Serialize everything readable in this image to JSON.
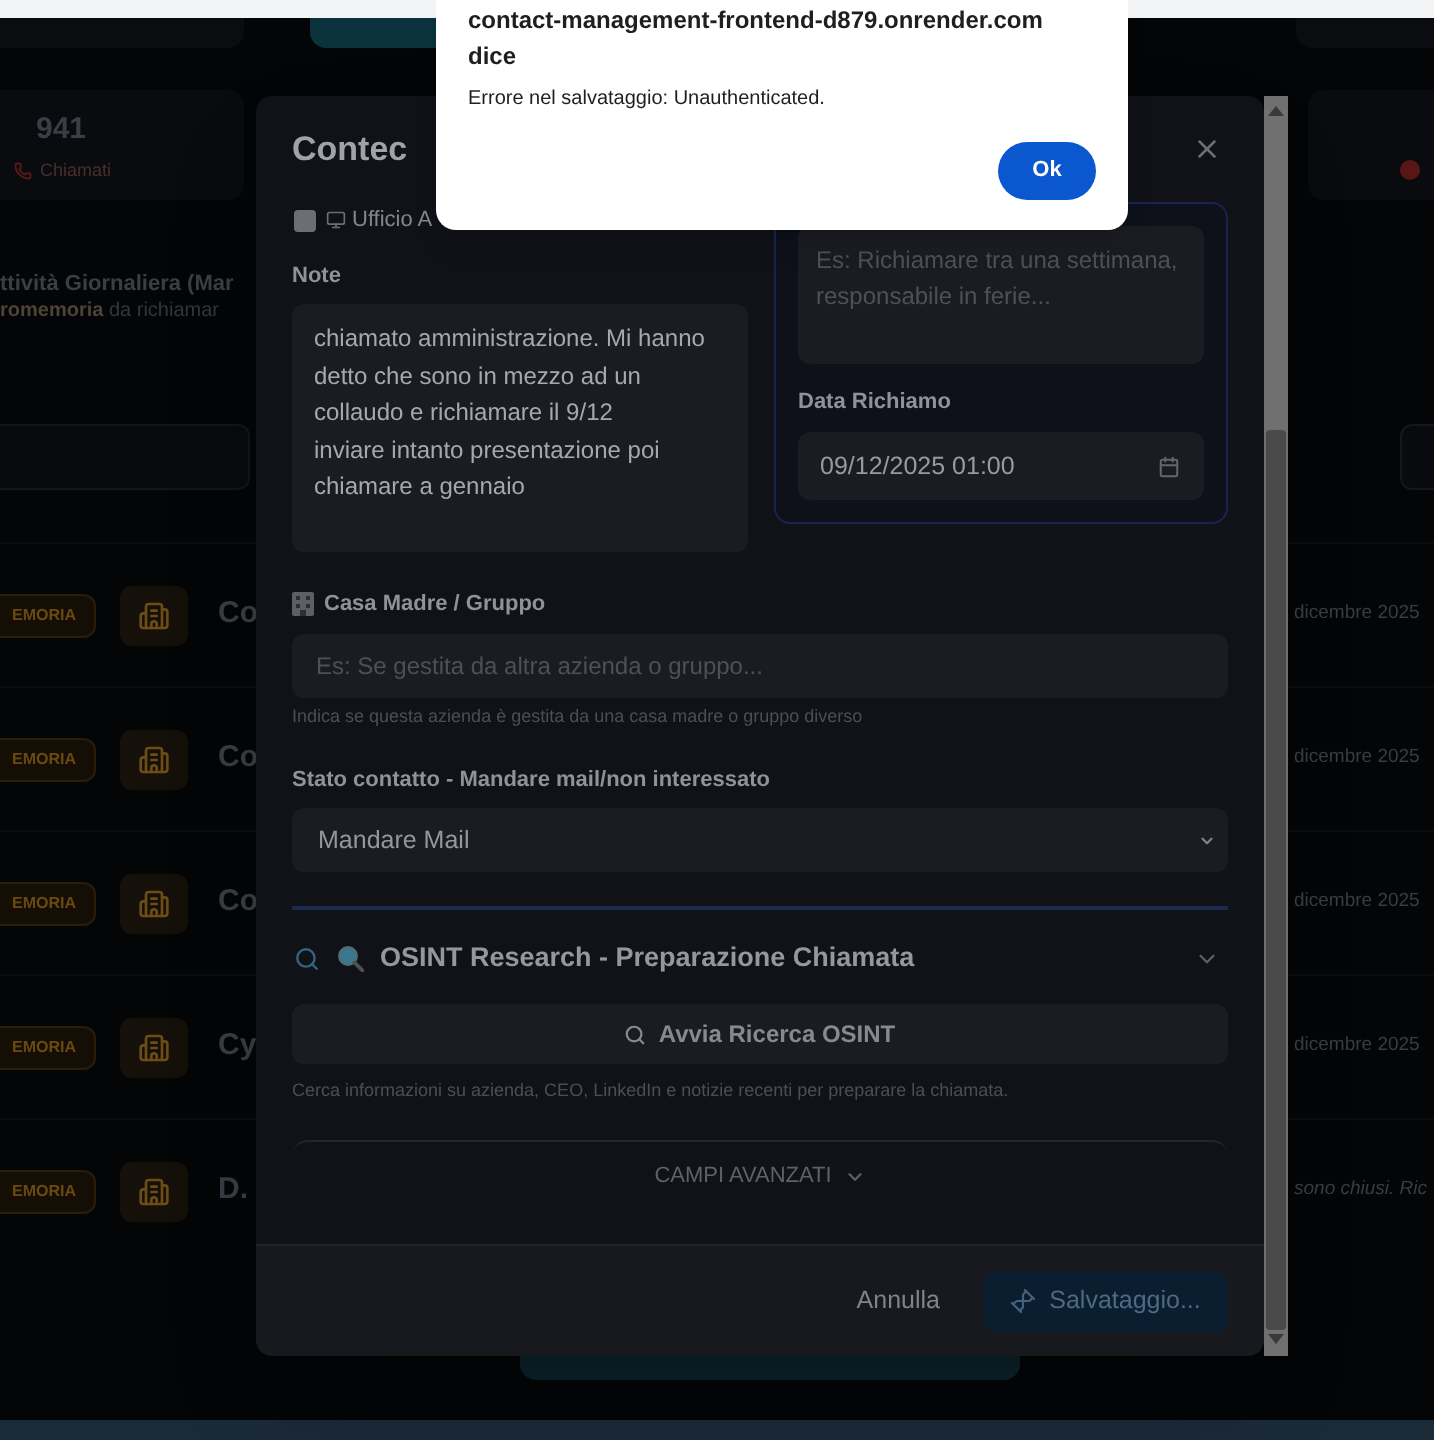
{
  "alert": {
    "title": "contact-management-frontend-d879.onrender.com dice",
    "message": "Errore nel salvataggio: Unauthenticated.",
    "button": "Ok"
  },
  "background_page": {
    "stat": {
      "value": "941",
      "label": "Chiamati"
    },
    "section_title": "ttività Giornaliera (Mar",
    "section_subtitle": "**romemoria** da richiamar",
    "rows": [
      {
        "badge": "EMORIA",
        "name": "Co",
        "kind": "date",
        "detail": "dicembre 2025"
      },
      {
        "badge": "EMORIA",
        "name": "Co",
        "kind": "date",
        "detail": "dicembre 2025"
      },
      {
        "badge": "EMORIA",
        "name": "Co",
        "kind": "date",
        "detail": "dicembre 2025"
      },
      {
        "badge": "EMORIA",
        "name": "Cy",
        "kind": "date",
        "detail": "dicembre 2025"
      },
      {
        "badge": "EMORIA",
        "name": "D.",
        "kind": "note",
        "detail": "sono chiusi. Ric"
      }
    ]
  },
  "modal": {
    "title": "Contec",
    "checkbox": {
      "label": "Ufficio A",
      "checked": false
    },
    "note": {
      "label": "Note",
      "value": "chiamato amministrazione. Mi hanno detto che sono in mezzo ad un collaudo e richiamare il 9/12\ninviare intanto presentazione poi chiamare a gennaio"
    },
    "recall": {
      "placeholder": "Es: Richiamare tra una settimana, responsabile in ferie...",
      "date_label": "Data Richiamo",
      "date_value": "09/12/2025 01:00"
    },
    "parent_company": {
      "label": "Casa Madre / Gruppo",
      "placeholder": "Es: Se gestita da altra azienda o gruppo...",
      "hint": "Indica se questa azienda è gestita da una casa madre o gruppo diverso"
    },
    "contact_status": {
      "label": "Stato contatto - Mandare mail/non interessato",
      "value": "Mandare Mail"
    },
    "osint": {
      "title": "OSINT Research - Preparazione Chiamata",
      "button": "Avvia Ricerca OSINT",
      "hint": "Cerca informazioni su azienda, CEO, LinkedIn e notizie recenti per preparare la chiamata."
    },
    "advanced": {
      "label": "CAMPI AVANZATI",
      "expanded": false
    },
    "footer": {
      "cancel": "Annulla",
      "save": {
        "label": "Salvataggio...",
        "disabled": true
      }
    }
  }
}
